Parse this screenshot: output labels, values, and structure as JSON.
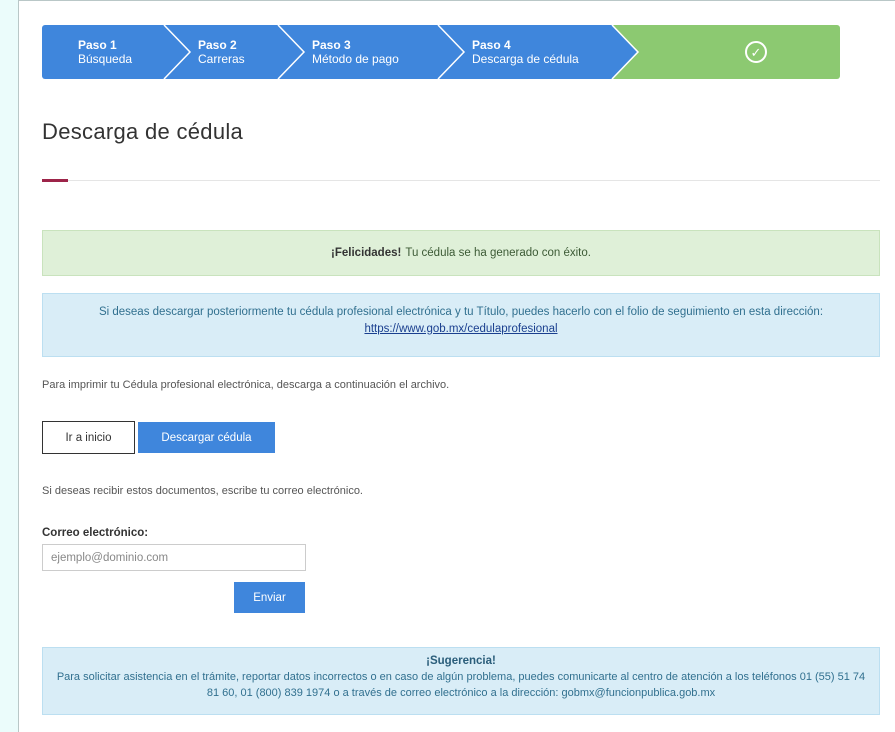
{
  "stepper": {
    "steps": [
      {
        "num": "Paso 1",
        "label": "Búsqueda"
      },
      {
        "num": "Paso 2",
        "label": "Carreras"
      },
      {
        "num": "Paso 3",
        "label": "Método de pago"
      },
      {
        "num": "Paso 4",
        "label": "Descarga de cédula"
      }
    ],
    "done_icon": "check-circle-icon",
    "colors": {
      "active": "#3f86dc",
      "done": "#8cc971"
    }
  },
  "page": {
    "title": "Descarga de cédula",
    "accent_color": "#9d2449"
  },
  "success_alert": {
    "strong": "¡Felicidades!",
    "text": "Tu cédula se ha generado con éxito."
  },
  "info_alert": {
    "text": "Si deseas descargar posteriormente tu cédula profesional electrónica y tu Título, puedes hacerlo con el folio de seguimiento en esta dirección:",
    "link": "https://www.gob.mx/cedulaprofesional"
  },
  "print_text": "Para imprimir tu Cédula profesional electrónica, descarga a continuación el archivo.",
  "buttons": {
    "home": "Ir a inicio",
    "download": "Descargar cédula",
    "send": "Enviar"
  },
  "email_section": {
    "intro": "Si deseas recibir estos documentos, escribe tu correo electrónico.",
    "label": "Correo electrónico:",
    "placeholder": "ejemplo@dominio.com"
  },
  "tip": {
    "title": "¡Sugerencia!",
    "text": "Para solicitar asistencia en el trámite, reportar datos incorrectos o en caso de algún problema, puedes comunicarte al centro de atención a los teléfonos 01 (55) 51 74 81 60, 01 (800) 839 1974 o a través de correo electrónico a la dirección: gobmx@funcionpublica.gob.mx"
  }
}
